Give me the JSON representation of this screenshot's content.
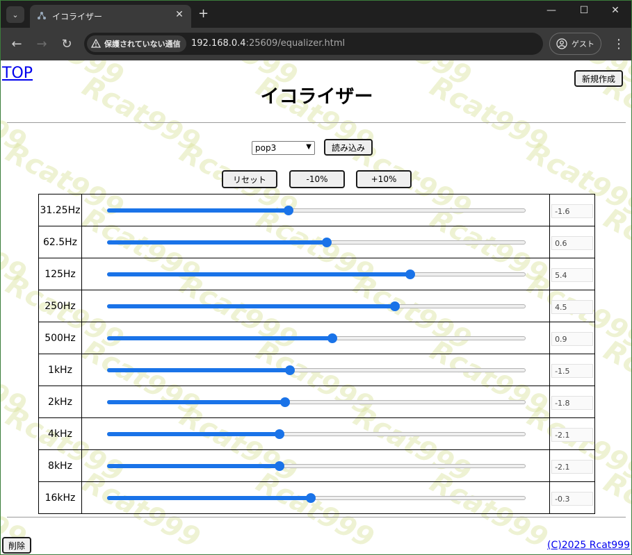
{
  "browser": {
    "tab_title": "イコライザー",
    "security_label": "保護されていない通信",
    "url_host": "192.168.0.4",
    "url_path": ":25609/equalizer.html",
    "profile_label": "ゲスト"
  },
  "page": {
    "top_link": "TOP",
    "new_button": "新規作成",
    "title": "イコライザー",
    "preset_selected": "pop3",
    "load_button": "読み込み",
    "reset_button": "リセット",
    "minus_button": "-10%",
    "plus_button": "+10%",
    "delete_button": "削除",
    "copyright": "(C)2025 Rcat999",
    "watermark": "Rcat999",
    "slider_range": [
      -12,
      12
    ]
  },
  "bands": [
    {
      "freq": "31.25Hz",
      "value": "-1.6"
    },
    {
      "freq": "62.5Hz",
      "value": "0.6"
    },
    {
      "freq": "125Hz",
      "value": "5.4"
    },
    {
      "freq": "250Hz",
      "value": "4.5"
    },
    {
      "freq": "500Hz",
      "value": "0.9"
    },
    {
      "freq": "1kHz",
      "value": "-1.5"
    },
    {
      "freq": "2kHz",
      "value": "-1.8"
    },
    {
      "freq": "4kHz",
      "value": "-2.1"
    },
    {
      "freq": "8kHz",
      "value": "-2.1"
    },
    {
      "freq": "16kHz",
      "value": "-0.3"
    }
  ]
}
